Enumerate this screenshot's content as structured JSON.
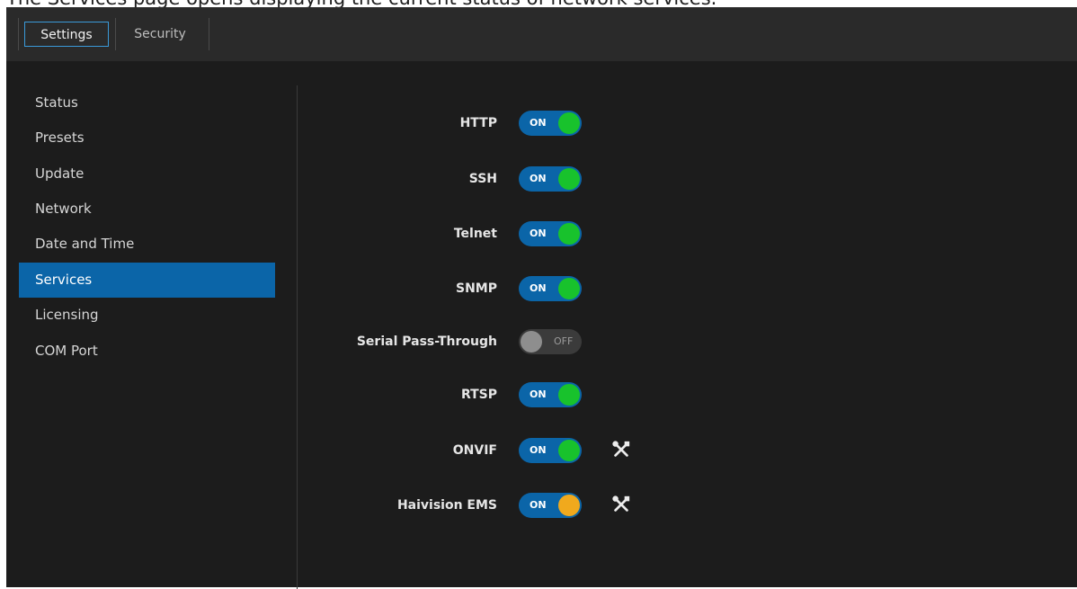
{
  "caption": "The Services page opens displaying the current status of network services.",
  "header": {
    "tabs": [
      {
        "label": "Settings",
        "active": true
      },
      {
        "label": "Security",
        "active": false
      }
    ]
  },
  "sidebar": {
    "items": [
      {
        "label": "Status"
      },
      {
        "label": "Presets"
      },
      {
        "label": "Update"
      },
      {
        "label": "Network"
      },
      {
        "label": "Date and Time"
      },
      {
        "label": "Services",
        "selected": true
      },
      {
        "label": "Licensing"
      },
      {
        "label": "COM Port"
      }
    ]
  },
  "services": [
    {
      "label": "HTTP",
      "state": "ON",
      "indicator": "green"
    },
    {
      "label": "SSH",
      "state": "ON",
      "indicator": "green"
    },
    {
      "label": "Telnet",
      "state": "ON",
      "indicator": "green"
    },
    {
      "label": "SNMP",
      "state": "ON",
      "indicator": "green"
    },
    {
      "label": "Serial Pass-Through",
      "state": "OFF",
      "indicator": "gray"
    },
    {
      "label": "RTSP",
      "state": "ON",
      "indicator": "green"
    },
    {
      "label": "ONVIF",
      "state": "ON",
      "indicator": "green",
      "settings_icon": "tools-icon"
    },
    {
      "label": "Haivision EMS",
      "state": "ON",
      "indicator": "amber",
      "settings_icon": "tools-icon"
    }
  ],
  "colors": {
    "accent": "#0b65a8",
    "status_green": "#18c22c",
    "status_amber": "#f0a91d",
    "off_gray": "#8e8e8e"
  }
}
